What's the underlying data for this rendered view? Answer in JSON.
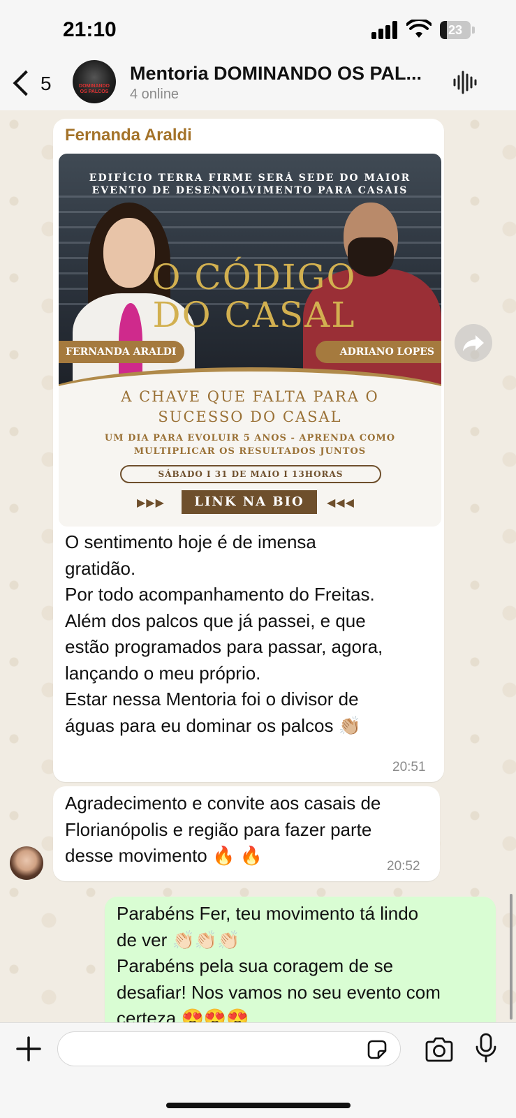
{
  "status_bar": {
    "time": "21:10",
    "battery": "23",
    "battery_level": 0.23
  },
  "header": {
    "back_count": "5",
    "title": "Mentoria DOMINANDO OS PAL...",
    "subtitle": "4 online"
  },
  "messages": [
    {
      "sender": "Fernanda Araldi",
      "flyer": {
        "headline_1": "EDIFÍCIO TERRA FIRME SERÁ SEDE DO MAIOR",
        "headline_2": "EVENTO DE DESENVOLVIMENTO PARA CASAIS",
        "title_1": "O CÓDIGO",
        "title_2": "DO CASAL",
        "name_left": "FERNANDA ARALDI",
        "name_right": "ADRIANO LOPES",
        "tagline_1": "A CHAVE QUE FALTA PARA O",
        "tagline_2": "SUCESSO DO CASAL",
        "sub_1": "UM DIA PARA EVOLUIR 5 ANOS - APRENDA COMO",
        "sub_2": "MULTIPLICAR OS RESULTADOS JUNTOS",
        "date": "SÁBADO I 31 DE MAIO I 13HORAS",
        "arrows_left": "▶▶▶",
        "arrows_right": "◀◀◀",
        "button": "LINK NA BIO"
      },
      "lines": [
        "O sentimento hoje é de imensa",
        "gratidão.",
        "Por todo acompanhamento do Freitas.",
        "Além dos palcos que já passei, e que",
        "estão programados para passar, agora,",
        "lançando o meu próprio.",
        "Estar nessa Mentoria foi o divisor de",
        "águas para eu dominar os palcos 👏🏼"
      ],
      "time": "20:51"
    },
    {
      "lines": [
        "Agradecimento e convite aos casais de",
        "Florianópolis e região para fazer parte",
        "desse movimento 🔥 🔥"
      ],
      "time": "20:52"
    },
    {
      "lines": [
        "Parabéns Fer, teu movimento tá lindo",
        "de ver 👏🏻👏🏻👏🏻",
        "Parabéns pela sua coragem de se",
        "desafiar! Nos vamos no seu evento com",
        "certeza 😍😍😍"
      ]
    }
  ],
  "composer": {
    "placeholder": ""
  },
  "icons": {
    "back": "chevron-left-icon",
    "voice": "waveform-icon",
    "forward": "forward-icon",
    "plus": "plus-icon",
    "sticker": "sticker-icon",
    "camera": "camera-icon",
    "mic": "microphone-icon"
  },
  "colors": {
    "sender_name": "#a4732a",
    "outgoing_bubble": "#d9fdd3",
    "flyer_gold": "#9a7136"
  }
}
